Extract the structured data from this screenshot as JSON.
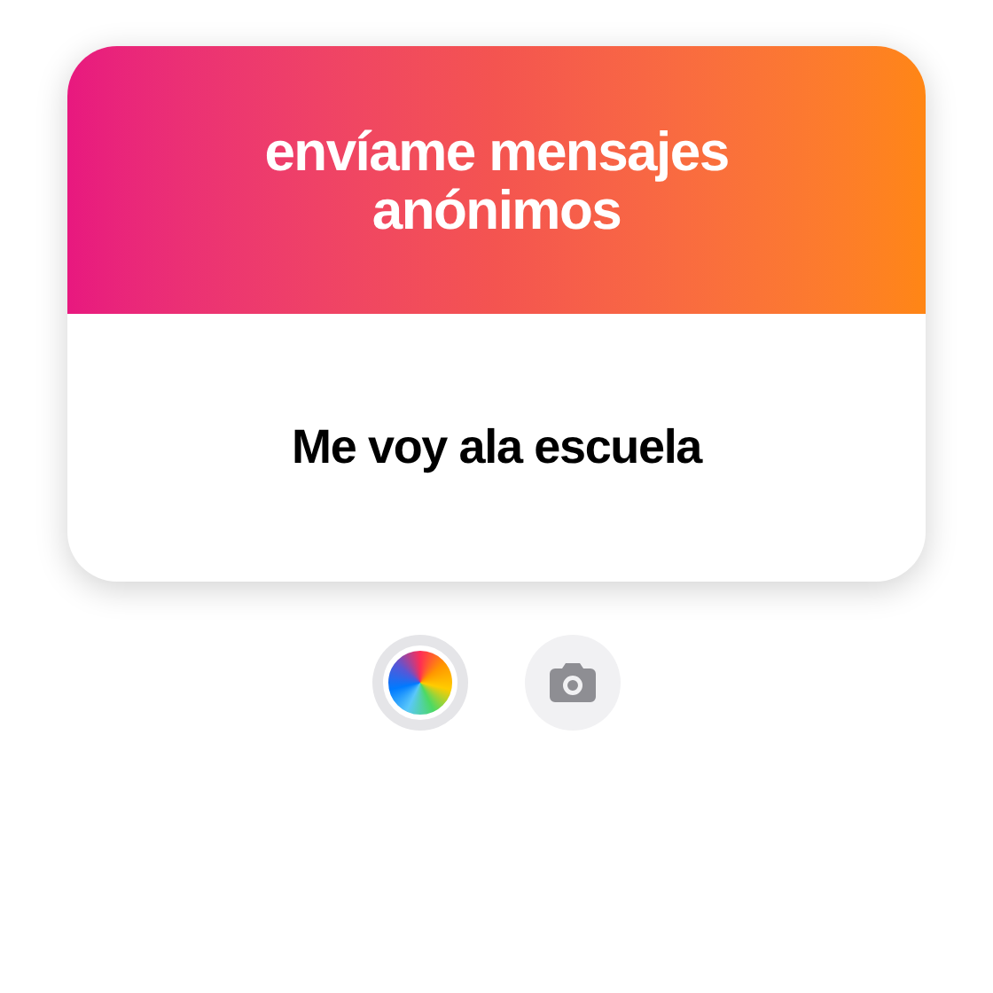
{
  "card": {
    "title": "envíame mensajes anónimos",
    "message": "Me voy ala escuela"
  },
  "controls": [
    {
      "kind": "color-wheel"
    },
    {
      "kind": "camera"
    }
  ]
}
